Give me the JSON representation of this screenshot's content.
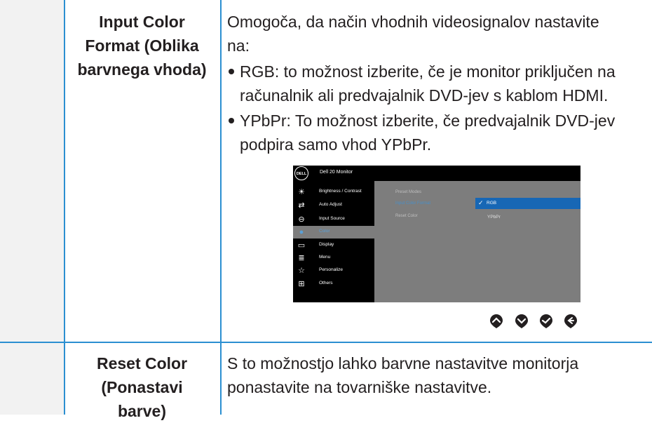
{
  "rows": [
    {
      "name_lines": [
        "Input Color",
        "Format (Oblika",
        "barvnega vhoda)"
      ],
      "desc_lines": [
        "Omogoča, da način vhodnih videosignalov nastavite",
        "na:"
      ],
      "bullets": [
        {
          "lines": [
            "RGB: to možnost izberite, če je monitor priključen na",
            "računalnik ali predvajalnik DVD-jev s kablom HDMI."
          ]
        },
        {
          "lines": [
            "YPbPr: To možnost izberite, če predvajalnik DVD-jev",
            "podpira samo vhod YPbPr."
          ]
        }
      ]
    },
    {
      "name_lines": [
        "Reset Color",
        "(Ponastavi",
        "barve)"
      ],
      "desc_lines": [
        "S to možnostjo lahko barvne nastavitve monitorja",
        "ponastavite na tovarniške nastavitve."
      ]
    }
  ],
  "osd": {
    "logo": "DELL",
    "title": "Dell 20 Monitor",
    "menu": [
      {
        "label": "Brightness / Contrast",
        "icon": "brightness-icon",
        "glyph": "☀"
      },
      {
        "label": "Auto Adjust",
        "icon": "auto-adjust-icon",
        "glyph": "⇄"
      },
      {
        "label": "Input Source",
        "icon": "input-source-icon",
        "glyph": "⊖"
      },
      {
        "label": "Color",
        "icon": "color-drop-icon",
        "glyph": "●"
      },
      {
        "label": "Display",
        "icon": "display-icon",
        "glyph": "▭"
      },
      {
        "label": "Menu",
        "icon": "menu-icon",
        "glyph": "≣"
      },
      {
        "label": "Personalize",
        "icon": "star-icon",
        "glyph": "☆"
      },
      {
        "label": "Others",
        "icon": "others-icon",
        "glyph": "⊞"
      }
    ],
    "active_menu": "Color",
    "submenu": [
      "Preset Modes",
      "Input Color Format",
      "Reset Color"
    ],
    "selected_submenu": "Input Color Format",
    "options": [
      "RGB",
      "YPbPr"
    ],
    "selected_option": "RGB"
  },
  "nav_buttons": [
    "up-button",
    "down-button",
    "select-button",
    "back-button"
  ],
  "colors": {
    "rule": "#2b8fd1",
    "shade": "#f2f2f2",
    "osd_highlight": "#1767b5"
  }
}
